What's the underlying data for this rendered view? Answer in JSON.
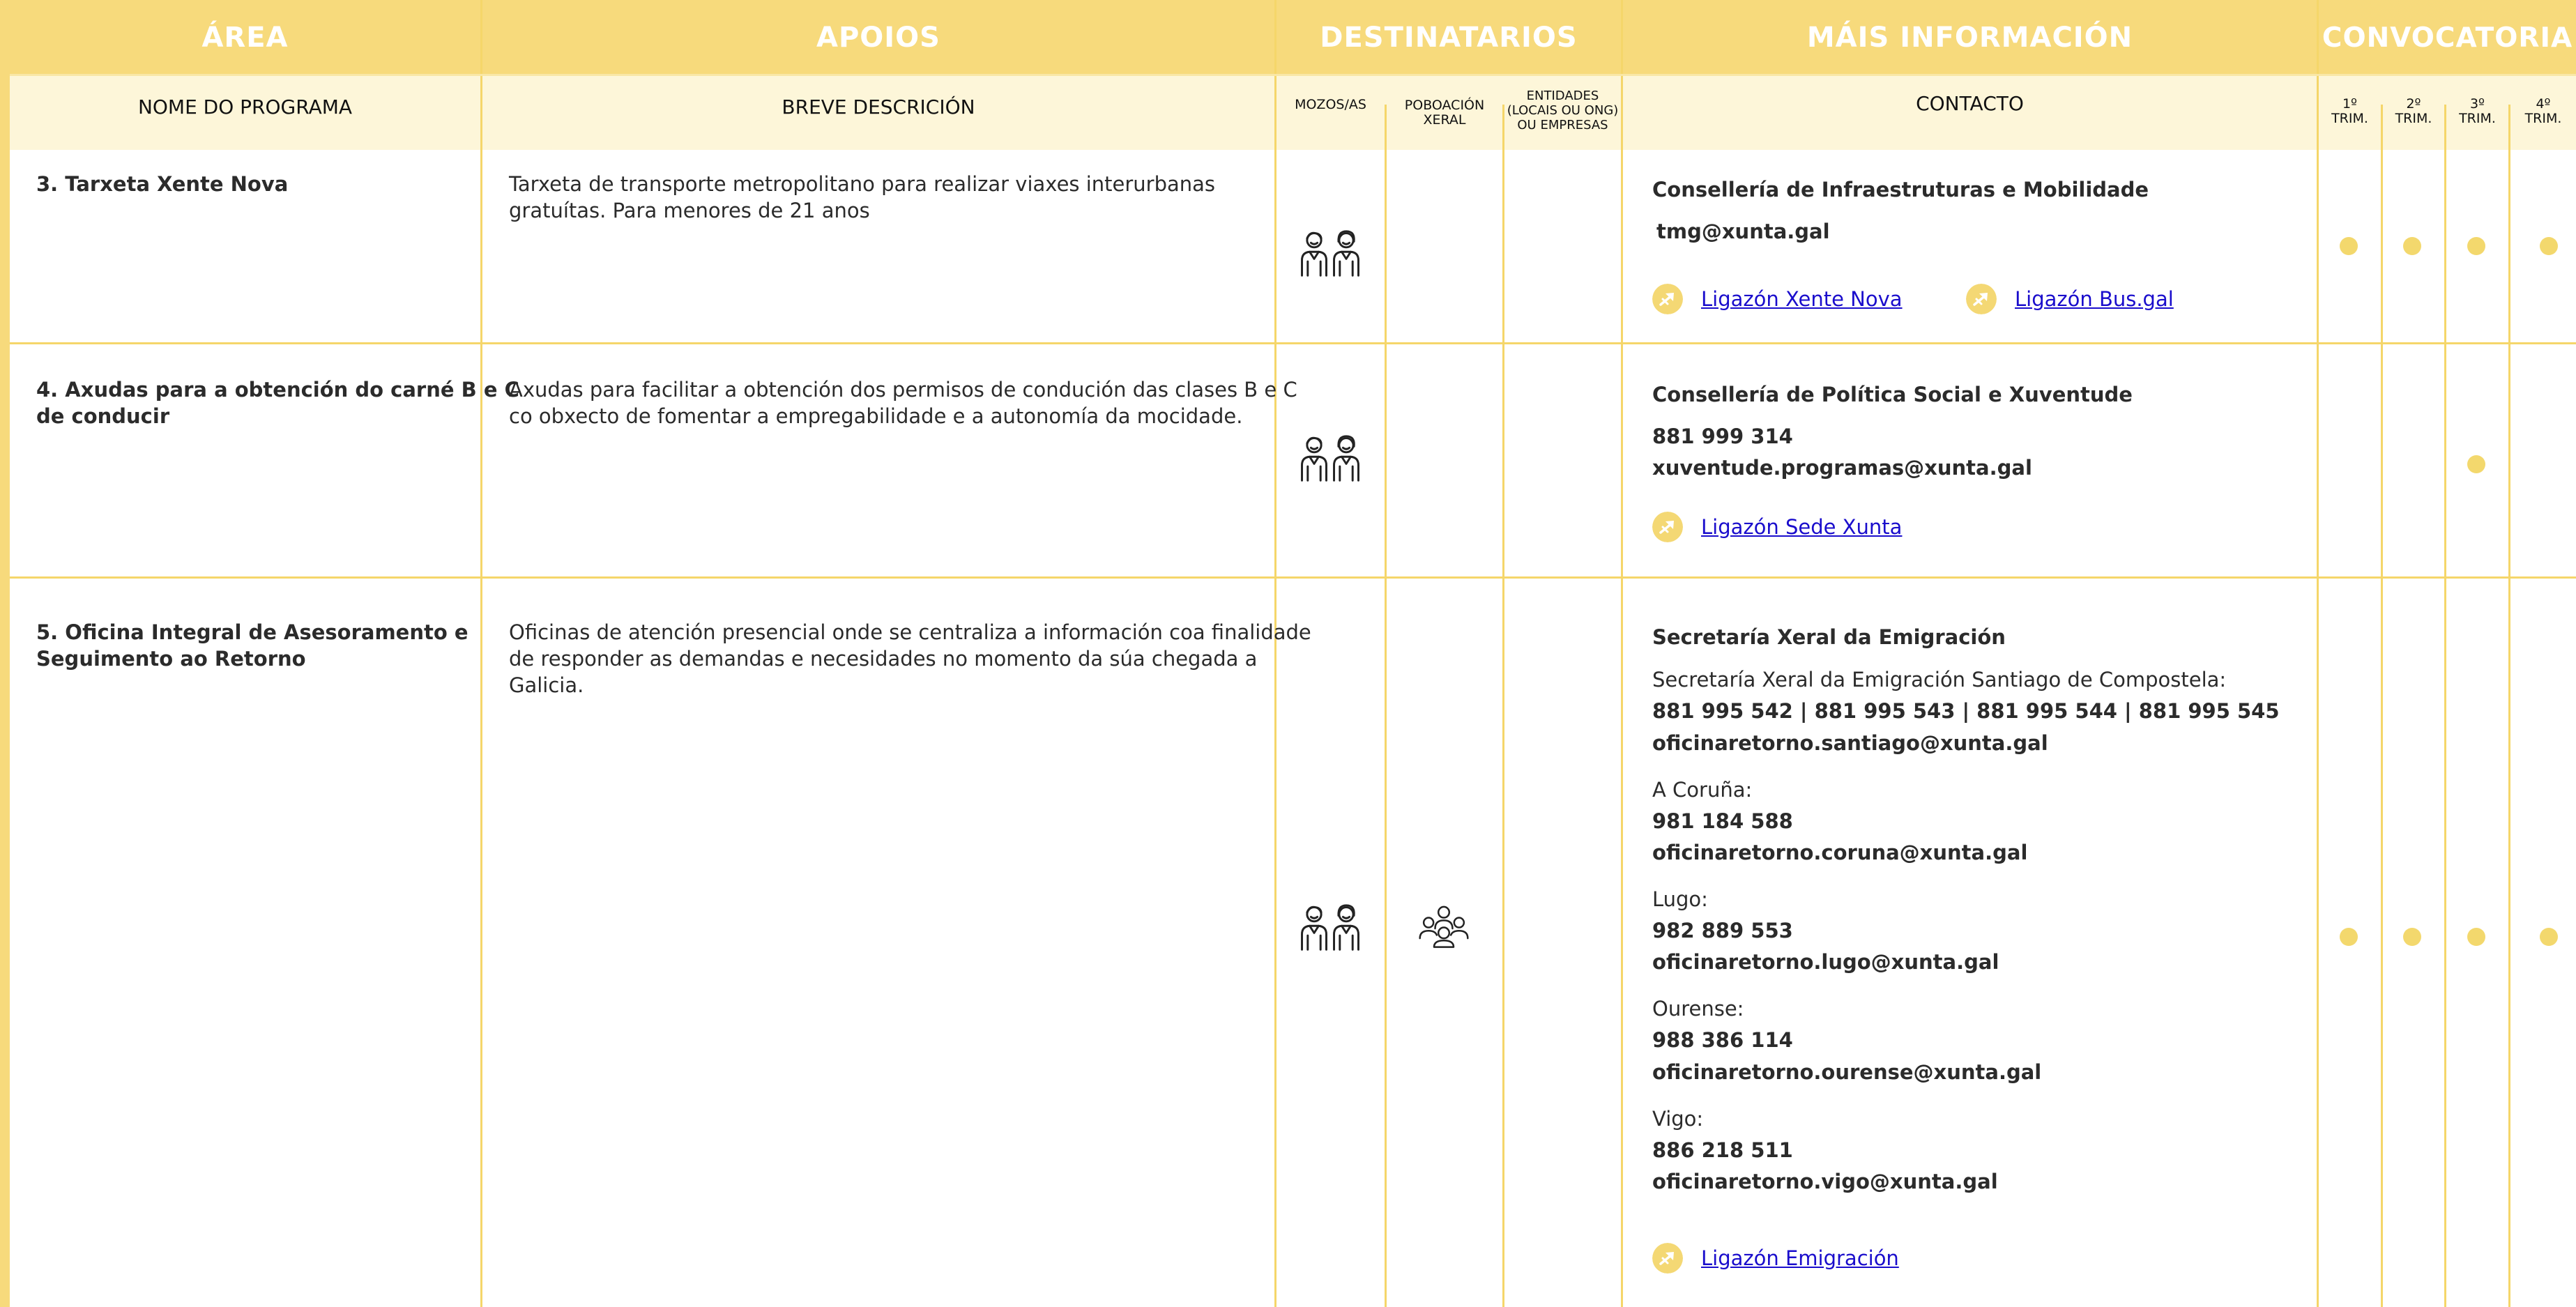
{
  "header": {
    "area": "ÁREA",
    "apoios": "APOIOS",
    "destinatarios": "DESTINATARIOS",
    "mais_informacion": "MÁIS INFORMACIÓN",
    "convocatoria": "CONVOCATORIA"
  },
  "subheader": {
    "nome": "NOME DO PROGRAMA",
    "breve": "BREVE DESCRICIÓN",
    "mozos_as": "MOZOS/AS",
    "poboacion_1": "POBOACIÓN",
    "poboacion_2": "XERAL",
    "entidades_1": "ENTIDADES",
    "entidades_2": "(LOCAIS OU ONG)",
    "entidades_3": "OU EMPRESAS",
    "contacto": "CONTACTO",
    "trim": "TRIM.",
    "q1": "1º",
    "q2": "2º",
    "q3": "3º",
    "q4": "4º"
  },
  "icons": {
    "youth": "youth-pair-icon",
    "group": "group-people-icon",
    "link": "arrow-link-icon"
  },
  "colors": {
    "accent": "#f7da7c",
    "sub_band": "#fdf6d9",
    "dot": "#f3d86d",
    "link": "#1a0dcc"
  },
  "rows": [
    {
      "program": "3. Tarxeta Xente Nova",
      "desc": [
        "Tarxeta de transporte metropolitano para realizar viaxes interurbanas",
        "gratuítas. Para menores de 21 anos"
      ],
      "org": "Consellería de Infraestruturas e Mobilidade",
      "email": "tmg@xunta.gal",
      "links": [
        "Ligazón Xente Nova",
        "Ligazón Bus.gal"
      ],
      "quarters": [
        true,
        true,
        true,
        true
      ]
    },
    {
      "program_1": "4. Axudas para a obtención do carné B e C",
      "program_2": "de conducir",
      "desc": [
        "Axudas para facilitar a obtención dos permisos de condución das clases B e C",
        "co obxecto de fomentar a empregabilidade e a autonomía da mocidade."
      ],
      "org": "Consellería de Política Social e Xuventude",
      "phone": "881 999 314",
      "email": "xuventude.programas@xunta.gal",
      "link": "Ligazón Sede Xunta",
      "quarters": [
        false,
        false,
        true,
        false
      ]
    },
    {
      "program_1": "5. Oficina Integral de Asesoramento e",
      "program_2": "Seguimento ao Retorno",
      "desc": [
        "Oficinas de atención presencial onde se centraliza a información coa finalidade",
        "de responder as demandas e necesidades no momento da súa chegada a",
        "Galicia."
      ],
      "org": "Secretaría Xeral da Emigración",
      "offices": [
        {
          "label": "Secretaría Xeral da Emigración Santiago de Compostela:",
          "phones": "881 995 542  |  881 995 543  |  881 995 544 |  881 995 545",
          "email": "oficinaretorno.santiago@xunta.gal"
        },
        {
          "label": "A Coruña:",
          "phones": "981 184 588",
          "email": "oficinaretorno.coruna@xunta.gal"
        },
        {
          "label": "Lugo:",
          "phones": "982 889 553",
          "email": "oficinaretorno.lugo@xunta.gal"
        },
        {
          "label": "Ourense:",
          "phones": "988 386 114",
          "email": "oficinaretorno.ourense@xunta.gal"
        },
        {
          "label": "Vigo:",
          "phones": "886 218 511",
          "email": "oficinaretorno.vigo@xunta.gal"
        }
      ],
      "link": "Ligazón Emigración",
      "quarters": [
        true,
        true,
        true,
        true
      ]
    }
  ]
}
